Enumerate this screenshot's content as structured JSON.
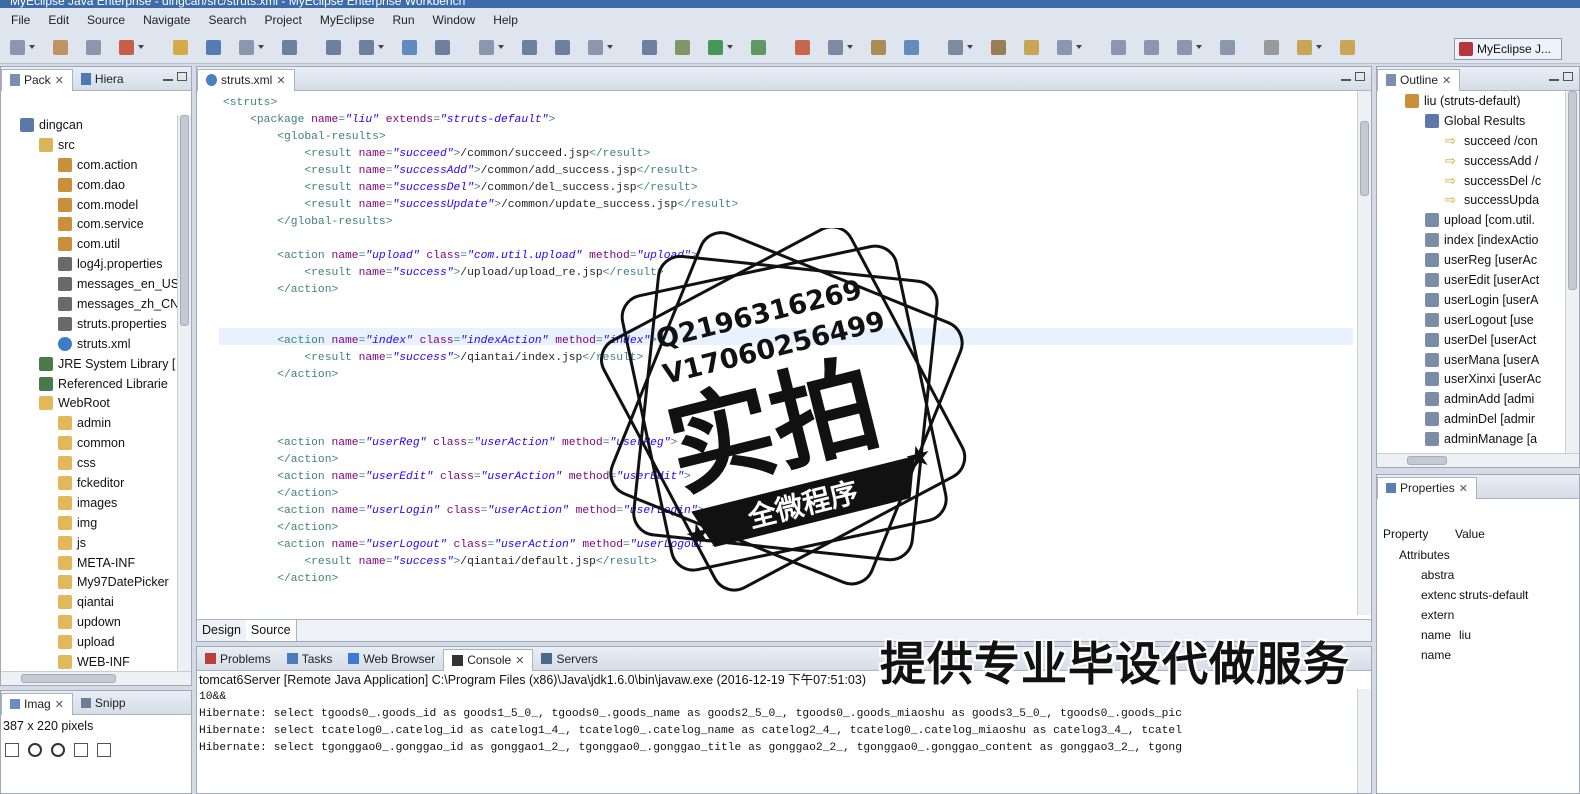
{
  "window": {
    "title": "MyEclipse Java Enterprise - dingcan/src/struts.xml - MyEclipse Enterprise Workbench"
  },
  "menu": [
    "File",
    "Edit",
    "Source",
    "Navigate",
    "Search",
    "Project",
    "MyEclipse",
    "Run",
    "Window",
    "Help"
  ],
  "perspective": {
    "label": "MyEclipse J..."
  },
  "explorer": {
    "tabs": [
      "Pack",
      "Hiera"
    ],
    "items": [
      {
        "label": "dingcan",
        "icon": "project-icon",
        "indent": 1
      },
      {
        "label": "src",
        "icon": "source-folder-icon",
        "indent": 2
      },
      {
        "label": "com.action",
        "icon": "package-icon",
        "indent": 3
      },
      {
        "label": "com.dao",
        "icon": "package-icon",
        "indent": 3
      },
      {
        "label": "com.model",
        "icon": "package-icon",
        "indent": 3
      },
      {
        "label": "com.service",
        "icon": "package-icon",
        "indent": 3
      },
      {
        "label": "com.util",
        "icon": "package-icon",
        "indent": 3
      },
      {
        "label": "log4j.properties",
        "icon": "properties-file-icon",
        "indent": 3
      },
      {
        "label": "messages_en_US",
        "icon": "properties-file-icon",
        "indent": 3
      },
      {
        "label": "messages_zh_CN",
        "icon": "properties-file-icon",
        "indent": 3
      },
      {
        "label": "struts.properties",
        "icon": "properties-file-icon",
        "indent": 3
      },
      {
        "label": "struts.xml",
        "icon": "xml-file-icon",
        "indent": 3
      },
      {
        "label": "JRE System Library [",
        "icon": "library-icon",
        "indent": 2
      },
      {
        "label": "Referenced Librarie",
        "icon": "library-icon",
        "indent": 2
      },
      {
        "label": "WebRoot",
        "icon": "folder-icon",
        "indent": 2
      },
      {
        "label": "admin",
        "icon": "folder-icon",
        "indent": 3
      },
      {
        "label": "common",
        "icon": "folder-icon",
        "indent": 3
      },
      {
        "label": "css",
        "icon": "folder-icon",
        "indent": 3
      },
      {
        "label": "fckeditor",
        "icon": "folder-icon",
        "indent": 3
      },
      {
        "label": "images",
        "icon": "folder-icon",
        "indent": 3
      },
      {
        "label": "img",
        "icon": "folder-icon",
        "indent": 3
      },
      {
        "label": "js",
        "icon": "folder-icon",
        "indent": 3
      },
      {
        "label": "META-INF",
        "icon": "folder-icon",
        "indent": 3
      },
      {
        "label": "My97DatePicker",
        "icon": "folder-icon",
        "indent": 3
      },
      {
        "label": "qiantai",
        "icon": "folder-icon",
        "indent": 3
      },
      {
        "label": "updown",
        "icon": "folder-icon",
        "indent": 3
      },
      {
        "label": "upload",
        "icon": "folder-icon",
        "indent": 3
      },
      {
        "label": "WEB-INF",
        "icon": "folder-icon",
        "indent": 3
      }
    ]
  },
  "imagePanel": {
    "tabs": [
      "Imag",
      "Snipp"
    ],
    "size": "387 x 220 pixels"
  },
  "editor": {
    "tab": "struts.xml",
    "bottomTabs": [
      "Design",
      "Source"
    ],
    "lines": [
      [
        [
          "tg",
          "<struts>"
        ]
      ],
      [
        [
          "tg",
          "    <package "
        ],
        [
          "an",
          "name"
        ],
        [
          "tg",
          "="
        ],
        [
          "av",
          "\"liu\""
        ],
        [
          "tg",
          " "
        ],
        [
          "an",
          "extends"
        ],
        [
          "tg",
          "="
        ],
        [
          "av",
          "\"struts-default\""
        ],
        [
          "tg",
          ">"
        ]
      ],
      [
        [
          "tg",
          "        <global-results>"
        ]
      ],
      [
        [
          "tg",
          "            <result "
        ],
        [
          "an",
          "name"
        ],
        [
          "tg",
          "="
        ],
        [
          "av",
          "\"succeed\""
        ],
        [
          "tg",
          ">"
        ],
        [
          "tx",
          "/common/succeed.jsp"
        ],
        [
          "tg",
          "</result>"
        ]
      ],
      [
        [
          "tg",
          "            <result "
        ],
        [
          "an",
          "name"
        ],
        [
          "tg",
          "="
        ],
        [
          "av",
          "\"successAdd\""
        ],
        [
          "tg",
          ">"
        ],
        [
          "tx",
          "/common/add_success.jsp"
        ],
        [
          "tg",
          "</result>"
        ]
      ],
      [
        [
          "tg",
          "            <result "
        ],
        [
          "an",
          "name"
        ],
        [
          "tg",
          "="
        ],
        [
          "av",
          "\"successDel\""
        ],
        [
          "tg",
          ">"
        ],
        [
          "tx",
          "/common/del_success.jsp"
        ],
        [
          "tg",
          "</result>"
        ]
      ],
      [
        [
          "tg",
          "            <result "
        ],
        [
          "an",
          "name"
        ],
        [
          "tg",
          "="
        ],
        [
          "av",
          "\"successUpdate\""
        ],
        [
          "tg",
          ">"
        ],
        [
          "tx",
          "/common/update_success.jsp"
        ],
        [
          "tg",
          "</result>"
        ]
      ],
      [
        [
          "tg",
          "        </global-results>"
        ]
      ],
      [
        [
          "tx",
          ""
        ]
      ],
      [
        [
          "tg",
          "        <action "
        ],
        [
          "an",
          "name"
        ],
        [
          "tg",
          "="
        ],
        [
          "av",
          "\"upload\""
        ],
        [
          "tg",
          " "
        ],
        [
          "an",
          "class"
        ],
        [
          "tg",
          "="
        ],
        [
          "av",
          "\"com.util.upload\""
        ],
        [
          "tg",
          " "
        ],
        [
          "an",
          "method"
        ],
        [
          "tg",
          "="
        ],
        [
          "av",
          "\"upload\""
        ],
        [
          "tg",
          ">"
        ]
      ],
      [
        [
          "tg",
          "            <result "
        ],
        [
          "an",
          "name"
        ],
        [
          "tg",
          "="
        ],
        [
          "av",
          "\"success\""
        ],
        [
          "tg",
          ">"
        ],
        [
          "tx",
          "/upload/upload_re.jsp"
        ],
        [
          "tg",
          "</result>"
        ]
      ],
      [
        [
          "tg",
          "        </action>"
        ]
      ],
      [
        [
          "tx",
          ""
        ]
      ],
      [
        [
          "tx",
          ""
        ]
      ],
      [
        [
          "tg",
          "        <action "
        ],
        [
          "an",
          "name"
        ],
        [
          "tg",
          "="
        ],
        [
          "av",
          "\"index\""
        ],
        [
          "tg",
          " "
        ],
        [
          "an",
          "class"
        ],
        [
          "tg",
          "="
        ],
        [
          "av",
          "\"indexAction\""
        ],
        [
          "tg",
          " "
        ],
        [
          "an",
          "method"
        ],
        [
          "tg",
          "="
        ],
        [
          "av",
          "\"index\""
        ],
        [
          "tg",
          ">"
        ]
      ],
      [
        [
          "tg",
          "            <result "
        ],
        [
          "an",
          "name"
        ],
        [
          "tg",
          "="
        ],
        [
          "av",
          "\"success\""
        ],
        [
          "tg",
          ">"
        ],
        [
          "tx",
          "/qiantai/index.jsp"
        ],
        [
          "tg",
          "</result>"
        ]
      ],
      [
        [
          "tg",
          "        </action>"
        ]
      ],
      [
        [
          "tx",
          ""
        ]
      ],
      [
        [
          "tx",
          ""
        ]
      ],
      [
        [
          "tx",
          ""
        ]
      ],
      [
        [
          "tg",
          "        <action "
        ],
        [
          "an",
          "name"
        ],
        [
          "tg",
          "="
        ],
        [
          "av",
          "\"userReg\""
        ],
        [
          "tg",
          " "
        ],
        [
          "an",
          "class"
        ],
        [
          "tg",
          "="
        ],
        [
          "av",
          "\"userAction\""
        ],
        [
          "tg",
          " "
        ],
        [
          "an",
          "method"
        ],
        [
          "tg",
          "="
        ],
        [
          "av",
          "\"userReg\""
        ],
        [
          "tg",
          ">"
        ]
      ],
      [
        [
          "tg",
          "        </action>"
        ]
      ],
      [
        [
          "tg",
          "        <action "
        ],
        [
          "an",
          "name"
        ],
        [
          "tg",
          "="
        ],
        [
          "av",
          "\"userEdit\""
        ],
        [
          "tg",
          " "
        ],
        [
          "an",
          "class"
        ],
        [
          "tg",
          "="
        ],
        [
          "av",
          "\"userAction\""
        ],
        [
          "tg",
          " "
        ],
        [
          "an",
          "method"
        ],
        [
          "tg",
          "="
        ],
        [
          "av",
          "\"userEdit\""
        ],
        [
          "tg",
          ">"
        ]
      ],
      [
        [
          "tg",
          "        </action>"
        ]
      ],
      [
        [
          "tg",
          "        <action "
        ],
        [
          "an",
          "name"
        ],
        [
          "tg",
          "="
        ],
        [
          "av",
          "\"userLogin\""
        ],
        [
          "tg",
          " "
        ],
        [
          "an",
          "class"
        ],
        [
          "tg",
          "="
        ],
        [
          "av",
          "\"userAction\""
        ],
        [
          "tg",
          " "
        ],
        [
          "an",
          "method"
        ],
        [
          "tg",
          "="
        ],
        [
          "av",
          "\"userLogin\""
        ],
        [
          "tg",
          ">"
        ]
      ],
      [
        [
          "tg",
          "        </action>"
        ]
      ],
      [
        [
          "tg",
          "        <action "
        ],
        [
          "an",
          "name"
        ],
        [
          "tg",
          "="
        ],
        [
          "av",
          "\"userLogout\""
        ],
        [
          "tg",
          " "
        ],
        [
          "an",
          "class"
        ],
        [
          "tg",
          "="
        ],
        [
          "av",
          "\"userAction\""
        ],
        [
          "tg",
          " "
        ],
        [
          "an",
          "method"
        ],
        [
          "tg",
          "="
        ],
        [
          "av",
          "\"userLogout\""
        ],
        [
          "tg",
          ">"
        ]
      ],
      [
        [
          "tg",
          "            <result "
        ],
        [
          "an",
          "name"
        ],
        [
          "tg",
          "="
        ],
        [
          "av",
          "\"success\""
        ],
        [
          "tg",
          ">"
        ],
        [
          "tx",
          "/qiantai/default.jsp"
        ],
        [
          "tg",
          "</result>"
        ]
      ],
      [
        [
          "tg",
          "        </action>"
        ]
      ]
    ]
  },
  "outline": {
    "tab": "Outline",
    "items": [
      {
        "label": "liu  (struts-default)",
        "icon": "package-icon",
        "indent": 2
      },
      {
        "label": "Global Results",
        "icon": "global-results-icon",
        "indent": 3
      },
      {
        "label": "succeed /con",
        "icon": "result-arrow-icon",
        "indent": 4
      },
      {
        "label": "successAdd /",
        "icon": "result-arrow-icon",
        "indent": 4
      },
      {
        "label": "successDel /c",
        "icon": "result-arrow-icon",
        "indent": 4
      },
      {
        "label": "successUpda",
        "icon": "result-arrow-icon",
        "indent": 4
      },
      {
        "label": "upload [com.util.",
        "icon": "action-icon",
        "indent": 3
      },
      {
        "label": "index [indexActio",
        "icon": "action-icon",
        "indent": 3
      },
      {
        "label": "userReg [userAc",
        "icon": "action-icon",
        "indent": 3
      },
      {
        "label": "userEdit [userAct",
        "icon": "action-icon",
        "indent": 3
      },
      {
        "label": "userLogin [userA",
        "icon": "action-icon",
        "indent": 3
      },
      {
        "label": "userLogout [use",
        "icon": "action-icon",
        "indent": 3
      },
      {
        "label": "userDel [userAct",
        "icon": "action-icon",
        "indent": 3
      },
      {
        "label": "userMana [userA",
        "icon": "action-icon",
        "indent": 3
      },
      {
        "label": "userXinxi [userAc",
        "icon": "action-icon",
        "indent": 3
      },
      {
        "label": "adminAdd [admi",
        "icon": "action-icon",
        "indent": 3
      },
      {
        "label": "adminDel [admir",
        "icon": "action-icon",
        "indent": 3
      },
      {
        "label": "adminManage [a",
        "icon": "action-icon",
        "indent": 3
      }
    ]
  },
  "properties": {
    "tab": "Properties",
    "header": {
      "property": "Property",
      "value": "Value"
    },
    "rows": [
      {
        "k": "Attributes",
        "v": "",
        "indent": 1
      },
      {
        "k": "abstra",
        "v": "",
        "indent": 2
      },
      {
        "k": "extenc",
        "v": "struts-default",
        "indent": 2
      },
      {
        "k": "extern",
        "v": "",
        "indent": 2
      },
      {
        "k": "name",
        "v": "liu",
        "indent": 2
      },
      {
        "k": "name",
        "v": "",
        "indent": 2
      }
    ]
  },
  "console": {
    "tabs": [
      "Problems",
      "Tasks",
      "Web Browser",
      "Console",
      "Servers"
    ],
    "header": "tomcat6Server [Remote Java Application] C:\\Program Files (x86)\\Java\\jdk1.6.0\\bin\\javaw.exe (2016-12-19 下午07:51:03)",
    "lines": [
      "10&&",
      "Hibernate: select tgoods0_.goods_id as goods1_5_0_, tgoods0_.goods_name as goods2_5_0_, tgoods0_.goods_miaoshu as goods3_5_0_, tgoods0_.goods_pic",
      "Hibernate: select tcatelog0_.catelog_id as catelog1_4_, tcatelog0_.catelog_name as catelog2_4_, tcatelog0_.catelog_miaoshu as catelog3_4_, tcatel",
      "Hibernate: select tgonggao0_.gonggao_id as gonggao1_2_, tgonggao0_.gonggao_title as gonggao2_2_, tgonggao0_.gonggao_content as gonggao3_2_, tgong"
    ]
  },
  "watermark": {
    "qq": "Q2196316269",
    "wx": "V17060256499",
    "big": "实拍",
    "ribbon": "全微程序",
    "bottom": "提供专业毕设代做服务"
  },
  "colors": {
    "accent": "#3d6aa8",
    "tag": "#3f7f7f",
    "attr": "#7f007f",
    "value": "#2a00ff"
  }
}
